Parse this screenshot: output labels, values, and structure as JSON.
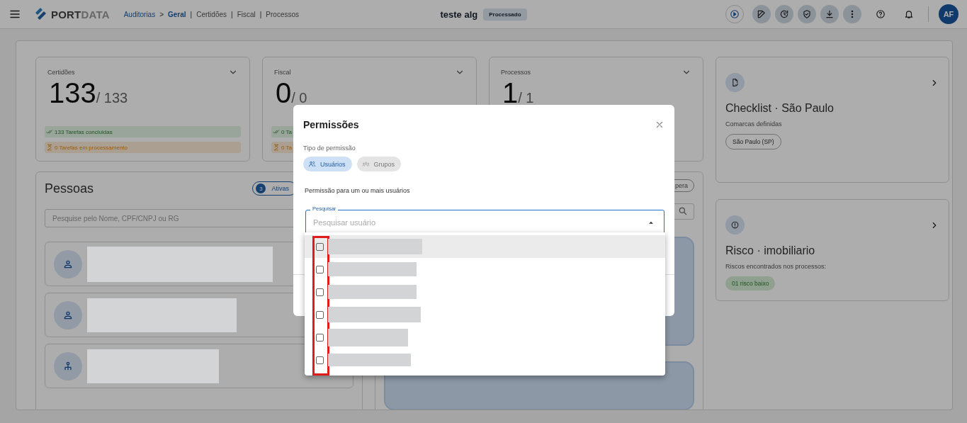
{
  "header": {
    "logo": {
      "strong": "PORT",
      "light": "DATA"
    },
    "breadcrumb": [
      {
        "label": "Auditorias",
        "kind": "link"
      },
      {
        "label": ">",
        "kind": "separator"
      },
      {
        "label": "Geral",
        "kind": "current"
      },
      {
        "label": "|",
        "kind": "separator"
      },
      {
        "label": "Certidões",
        "kind": "tab"
      },
      {
        "label": "|",
        "kind": "separator"
      },
      {
        "label": "Fiscal",
        "kind": "tab"
      },
      {
        "label": "|",
        "kind": "separator"
      },
      {
        "label": "Processos",
        "kind": "tab"
      }
    ],
    "title": "teste alg",
    "status_badge": "Processado",
    "avatar": "AF"
  },
  "stat_cards": [
    {
      "label": "Certidões",
      "value": "133",
      "total": "/ 133",
      "done": "133 Tarefas concluidas",
      "pending": "0 Tarefas em processamento"
    },
    {
      "label": "Fiscal",
      "value": "0",
      "total": "/ 0",
      "done": "0 Ta",
      "pending": "0 Ta"
    },
    {
      "label": "Processos",
      "value": "1",
      "total": "/ 1"
    }
  ],
  "pessoas": {
    "title": "Pessoas",
    "chips": [
      {
        "count": "3",
        "label": "Ativas",
        "selected": true
      }
    ],
    "search": {
      "placeholder": "Pesquise pelo Nome, CPF/CNPJ ou RG"
    },
    "people": [
      {
        "kind": "person"
      },
      {
        "kind": "person"
      },
      {
        "kind": "organization"
      }
    ]
  },
  "middle_card": {
    "chip": "pera"
  },
  "side_cards": [
    {
      "kind": "checklist",
      "title": "Checklist · São Paulo",
      "subtitle": "Comarcas definidas",
      "tag": {
        "label": "São Paulo (SP)",
        "kind": "outline"
      }
    },
    {
      "kind": "risk",
      "title": "Risco · imobiliario",
      "subtitle": "Riscos encontrados nos processos:",
      "tag": {
        "label": "01 risco baixo",
        "kind": "success"
      }
    }
  ],
  "dialog": {
    "title": "Permissões",
    "type_label": "Tipo de permissão",
    "types": [
      {
        "label": "Usuários",
        "kind": "users",
        "selected": true
      },
      {
        "label": "Grupos",
        "kind": "groups",
        "selected": false
      }
    ],
    "description": "Permissão para um ou mais usuários",
    "field": {
      "label": "Pesquisar",
      "placeholder": "Pesquisar usuário"
    },
    "options": [
      {
        "checked": false,
        "highlighted": true
      },
      {
        "checked": false,
        "highlighted": false
      },
      {
        "checked": false,
        "highlighted": false
      },
      {
        "checked": false,
        "highlighted": false
      },
      {
        "checked": false,
        "highlighted": false
      },
      {
        "checked": false,
        "highlighted": false
      }
    ]
  }
}
